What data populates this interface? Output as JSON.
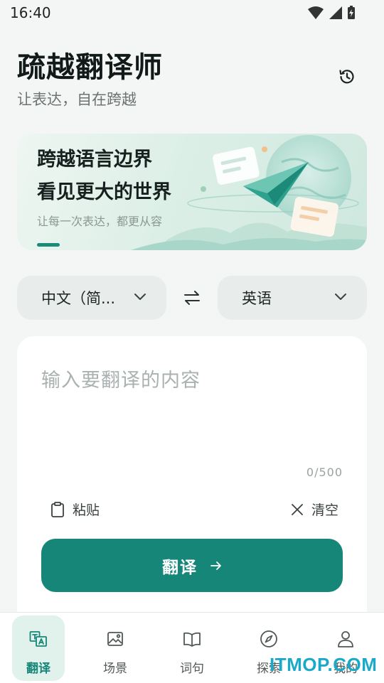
{
  "status_bar": {
    "time": "16:40",
    "icons": [
      "wifi-icon",
      "cellular-signal-icon",
      "battery-charging-icon"
    ]
  },
  "header": {
    "title": "疏越翻译师",
    "subtitle": "让表达，自在跨越",
    "history_icon": "history-icon"
  },
  "banner": {
    "line1": "跨越语言边界",
    "line2": "看见更大的世界",
    "caption": "让每一次表达，都更从容"
  },
  "languages": {
    "source": "中文（简...",
    "target": "英语",
    "swap_icon": "swap-arrows-icon"
  },
  "input": {
    "placeholder": "输入要翻译的内容",
    "char_count": "0/500",
    "paste_label": "粘贴",
    "clear_label": "清空",
    "translate_label": "翻译"
  },
  "nav": {
    "items": [
      {
        "label": "翻译",
        "icon": "translate-icon",
        "active": true
      },
      {
        "label": "场景",
        "icon": "image-icon",
        "active": false
      },
      {
        "label": "词句",
        "icon": "book-icon",
        "active": false
      },
      {
        "label": "探索",
        "icon": "compass-icon",
        "active": false
      },
      {
        "label": "我的",
        "icon": "person-icon",
        "active": false
      }
    ]
  },
  "watermark": "ITMOP.COM",
  "colors": {
    "accent": "#168679",
    "background": "#f4f6f5",
    "card": "#ffffff"
  }
}
